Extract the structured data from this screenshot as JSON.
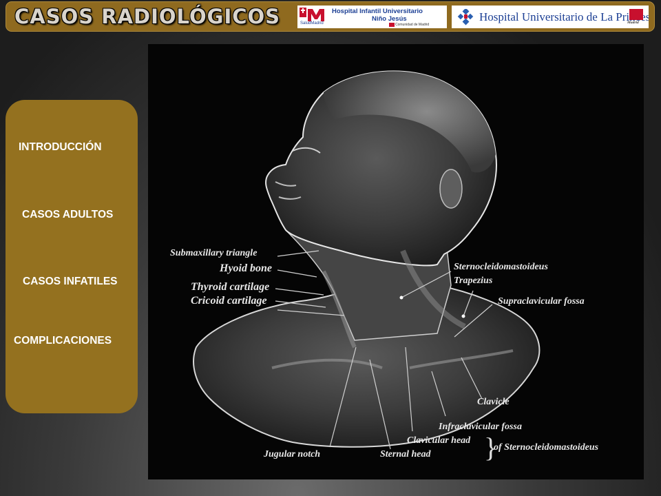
{
  "header": {
    "title": "CASOS RADIOLÓGICOS",
    "logos": [
      {
        "name": "hospital-nino-jesus",
        "line1": "Hospital Infantil Universitario",
        "line2": "Niño Jesús",
        "line3": "SaludMadrid",
        "line4": "Comunidad de Madrid",
        "accent": "#c8102e",
        "brand": "#1c3f94"
      },
      {
        "name": "hospital-la-princesa",
        "line1": "Hospital Universitario de La Princesa",
        "tag": "Madrid",
        "accent": "#c8102e",
        "brand": "#1c3f94"
      }
    ]
  },
  "sidebar": {
    "items": [
      {
        "label": "INTRODUCCIÓN"
      },
      {
        "label": "CASOS ADULTOS"
      },
      {
        "label": "CASOS INFATILES"
      },
      {
        "label": "COMPLICACIONES"
      }
    ]
  },
  "figure": {
    "labels": {
      "submaxillary": "Submaxillary triangle",
      "hyoid": "Hyoid bone",
      "thyroid": "Thyroid cartilage",
      "cricoid": "Cricoid cartilage",
      "sterno": "Sternocleidomastoideus",
      "trapezius": "Trapezius",
      "supraclavicular": "Supraclavicular fossa",
      "clavicle": "Clavicle",
      "infraclavicular": "Infraclavicular fossa",
      "clavicular_head": "Clavicular head",
      "sternal_head": "Sternal head",
      "of_sterno": "of Sternocleidomastoideus",
      "jugular": "Jugular notch"
    }
  },
  "colors": {
    "header_bg": "#8f6a1f",
    "sidebar_bg": "#94711f",
    "nav_text": "#ffffff"
  }
}
